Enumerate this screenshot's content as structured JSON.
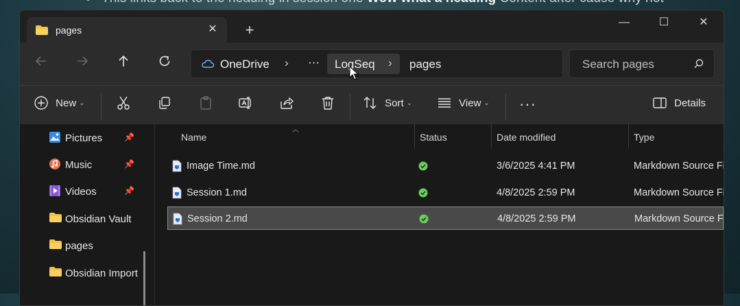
{
  "background_note_text": {
    "part1": "This links back to the heading in session one ",
    "bold": "Wow what a heading",
    "part2": " Content after cause why not"
  },
  "tab": {
    "title": "pages",
    "icon": "folder-icon"
  },
  "window": {
    "minimize": "—",
    "maximize": "☐",
    "close": "✕"
  },
  "nav": {
    "back": "back-arrow-icon",
    "forward": "forward-arrow-icon",
    "up": "up-arrow-icon",
    "refresh": "refresh-icon"
  },
  "breadcrumb": {
    "root": "OneDrive",
    "ellipsis": "···",
    "items": [
      "LogSeq",
      "pages"
    ]
  },
  "search": {
    "placeholder": "Search pages"
  },
  "commandbar": {
    "new_label": "New",
    "sort_label": "Sort",
    "view_label": "View",
    "more": "···",
    "details_label": "Details"
  },
  "sidebar": {
    "items": [
      {
        "label": "Pictures",
        "icon": "pictures-icon",
        "pinned": true
      },
      {
        "label": "Music",
        "icon": "music-icon",
        "pinned": true
      },
      {
        "label": "Videos",
        "icon": "videos-icon",
        "pinned": true
      },
      {
        "label": "Obsidian Vault",
        "icon": "folder-icon",
        "pinned": false
      },
      {
        "label": "pages",
        "icon": "folder-icon",
        "pinned": false
      },
      {
        "label": "Obsidian Import",
        "icon": "folder-icon",
        "pinned": false
      }
    ]
  },
  "columns": [
    "Name",
    "Status",
    "Date modified",
    "Type"
  ],
  "files": [
    {
      "name": "Image Time.md",
      "status": "synced",
      "date": "3/6/2025 4:41 PM",
      "type": "Markdown Source File",
      "selected": false
    },
    {
      "name": "Session 1.md",
      "status": "synced",
      "date": "4/8/2025 2:59 PM",
      "type": "Markdown Source File",
      "selected": false
    },
    {
      "name": "Session 2.md",
      "status": "synced",
      "date": "4/8/2025 2:59 PM",
      "type": "Markdown Source File",
      "selected": true
    }
  ],
  "colors": {
    "accent_green": "#6ccb5f",
    "folder": "#f5c242",
    "selection": "#494949"
  }
}
